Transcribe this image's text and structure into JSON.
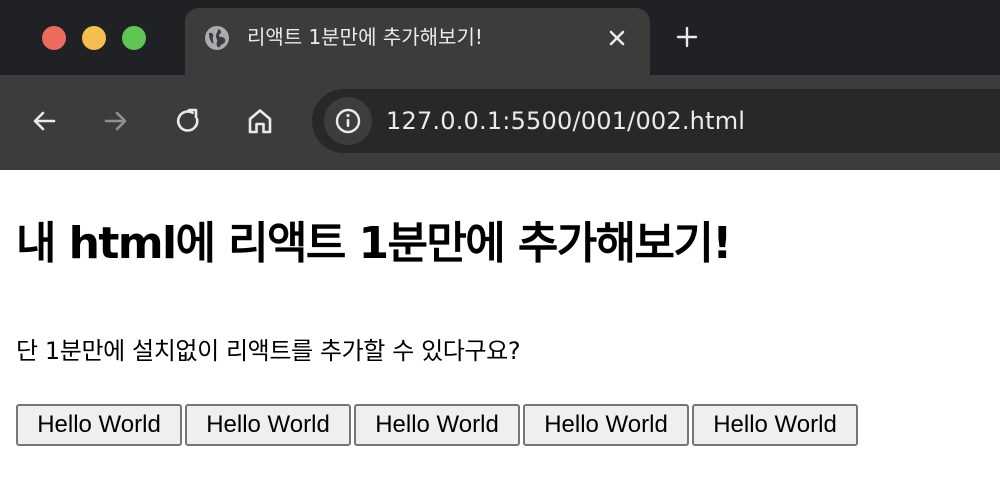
{
  "window": {
    "traffic_lights": [
      "close",
      "minimize",
      "zoom"
    ]
  },
  "tab": {
    "title": "리액트 1분만에 추가해보기!",
    "favicon": "globe-icon"
  },
  "toolbar": {
    "url": "127.0.0.1:5500/001/002.html"
  },
  "page": {
    "heading": "내 html에 리액트 1분만에 추가해보기!",
    "description": "단 1분만에 설치없이 리액트를 추가할 수 있다구요?",
    "buttons": [
      {
        "label": "Hello World"
      },
      {
        "label": "Hello World"
      },
      {
        "label": "Hello World"
      },
      {
        "label": "Hello World"
      },
      {
        "label": "Hello World"
      }
    ]
  },
  "colors": {
    "tabstrip": "#202124",
    "toolbar": "#3c3c3c",
    "omnibox": "#282828",
    "traffic_red": "#ed6a5e",
    "traffic_yellow": "#f5bf4f",
    "traffic_green": "#61c554"
  }
}
